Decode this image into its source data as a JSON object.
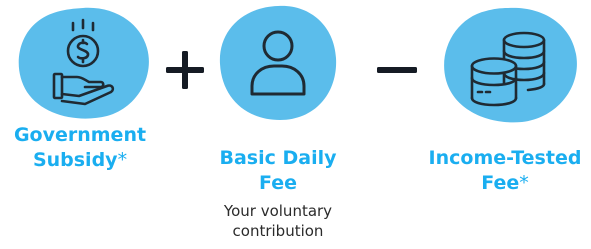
{
  "colors": {
    "accent": "#1aaef0",
    "circle_fill": "#5bbdeb",
    "icon_stroke": "#1f2a33",
    "operator": "#151b24",
    "text": "#2b2b2b"
  },
  "terms": [
    {
      "icon": "money-hand-icon",
      "title_line1": "Government",
      "title_line2": "Subsidy",
      "title_mark": "*",
      "subtitle": ""
    },
    {
      "icon": "person-icon",
      "title_line1": "Basic Daily",
      "title_line2": "Fee",
      "title_mark": "",
      "subtitle_line1": "Your voluntary",
      "subtitle_line2": "contribution"
    },
    {
      "icon": "coin-stack-icon",
      "title_line1": "Income-Tested",
      "title_line2": "Fee",
      "title_mark": "*",
      "subtitle": ""
    }
  ],
  "operators": [
    {
      "icon": "plus-icon",
      "symbol": "+"
    },
    {
      "icon": "minus-icon",
      "symbol": "−"
    }
  ]
}
